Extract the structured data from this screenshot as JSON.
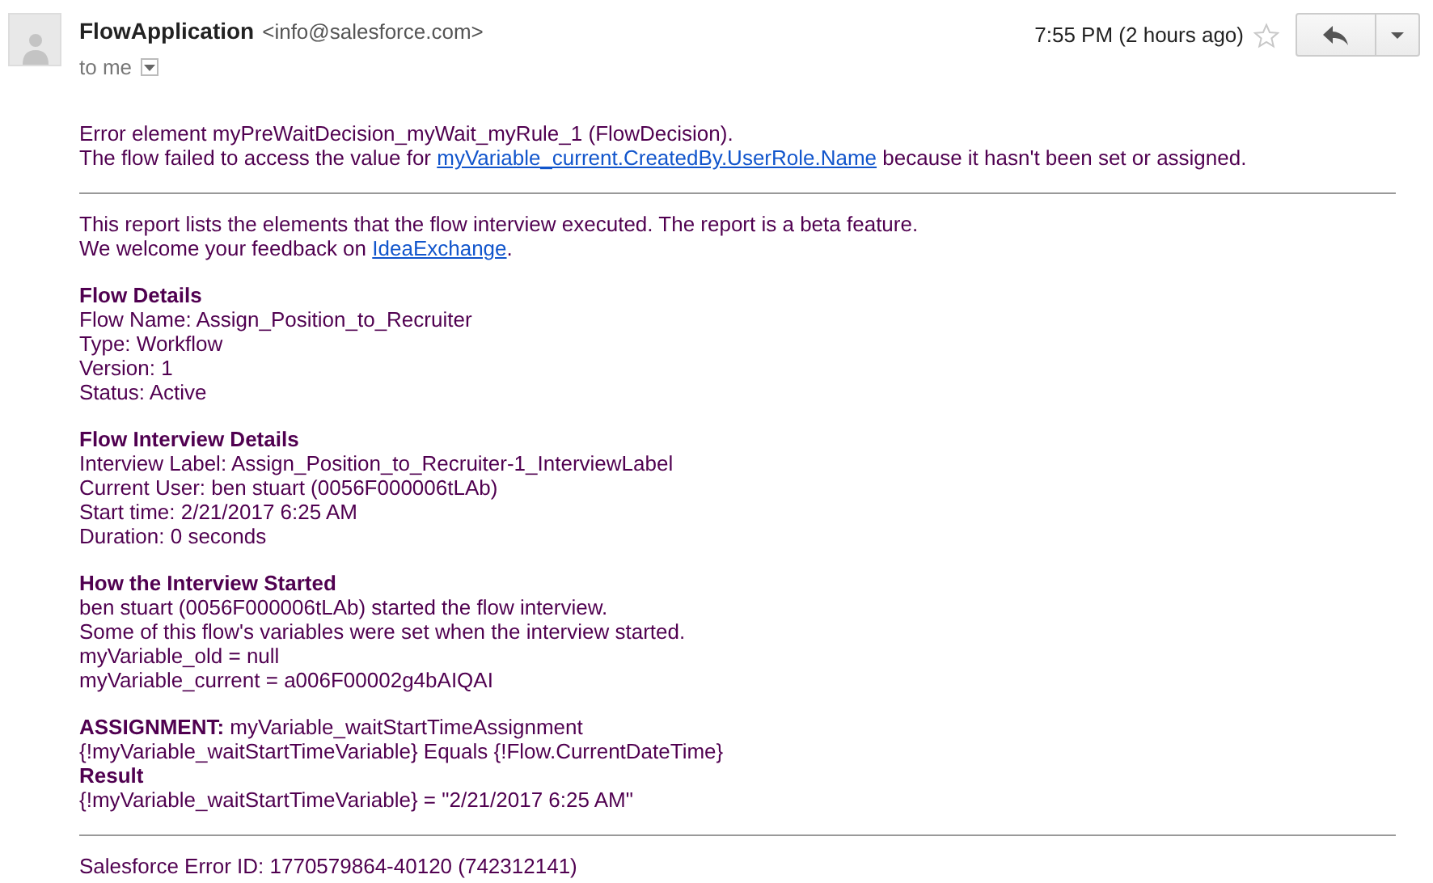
{
  "header": {
    "sender_name": "FlowApplication",
    "sender_email": "<info@salesforce.com>",
    "recipient": "to me",
    "time": "7:55 PM (2 hours ago)",
    "starred": false
  },
  "error_block": [
    {
      "kind": "text",
      "text": "Error element myPreWaitDecision_myWait_myRule_1 (FlowDecision)."
    },
    {
      "kind": "link_line",
      "before": "The flow failed to access the value for ",
      "link": "myVariable_current.CreatedBy.UserRole.Name",
      "after": " because it hasn't been set or assigned."
    }
  ],
  "report": [
    [
      {
        "kind": "text",
        "text": "This report lists the elements that the flow interview executed. The report is a beta feature."
      },
      {
        "kind": "link_line",
        "before": "We welcome your feedback on ",
        "link": "IdeaExchange",
        "after": "."
      }
    ],
    [
      {
        "kind": "heading",
        "text": "Flow Details"
      },
      {
        "kind": "text",
        "text": "Flow Name: Assign_Position_to_Recruiter"
      },
      {
        "kind": "text",
        "text": "Type: Workflow"
      },
      {
        "kind": "text",
        "text": "Version: 1"
      },
      {
        "kind": "text",
        "text": "Status: Active"
      }
    ],
    [
      {
        "kind": "heading",
        "text": "Flow Interview Details"
      },
      {
        "kind": "text",
        "text": "Interview Label: Assign_Position_to_Recruiter-1_InterviewLabel"
      },
      {
        "kind": "text",
        "text": "Current User: ben stuart (0056F000006tLAb)"
      },
      {
        "kind": "text",
        "text": "Start time: 2/21/2017 6:25 AM"
      },
      {
        "kind": "text",
        "text": "Duration: 0 seconds"
      }
    ],
    [
      {
        "kind": "heading",
        "text": "How the Interview Started"
      },
      {
        "kind": "text",
        "text": "ben stuart (0056F000006tLAb) started the flow interview."
      },
      {
        "kind": "text",
        "text": "Some of this flow's variables were set when the interview started."
      },
      {
        "kind": "text",
        "text": "myVariable_old = null"
      },
      {
        "kind": "text",
        "text": "myVariable_current = a006F00002g4bAIQAI"
      }
    ],
    [
      {
        "kind": "text",
        "text": "**ASSIGNMENT:** myVariable_waitStartTimeAssignment"
      },
      {
        "kind": "text",
        "text": "{!myVariable_waitStartTimeVariable} Equals {!Flow.CurrentDateTime}"
      },
      {
        "kind": "heading",
        "text": "Result"
      },
      {
        "kind": "text",
        "text": "{!myVariable_waitStartTimeVariable} = \"2/21/2017 6:25 AM\""
      }
    ]
  ],
  "footer": "Salesforce Error ID: 1770579864-40120 (742312141)"
}
